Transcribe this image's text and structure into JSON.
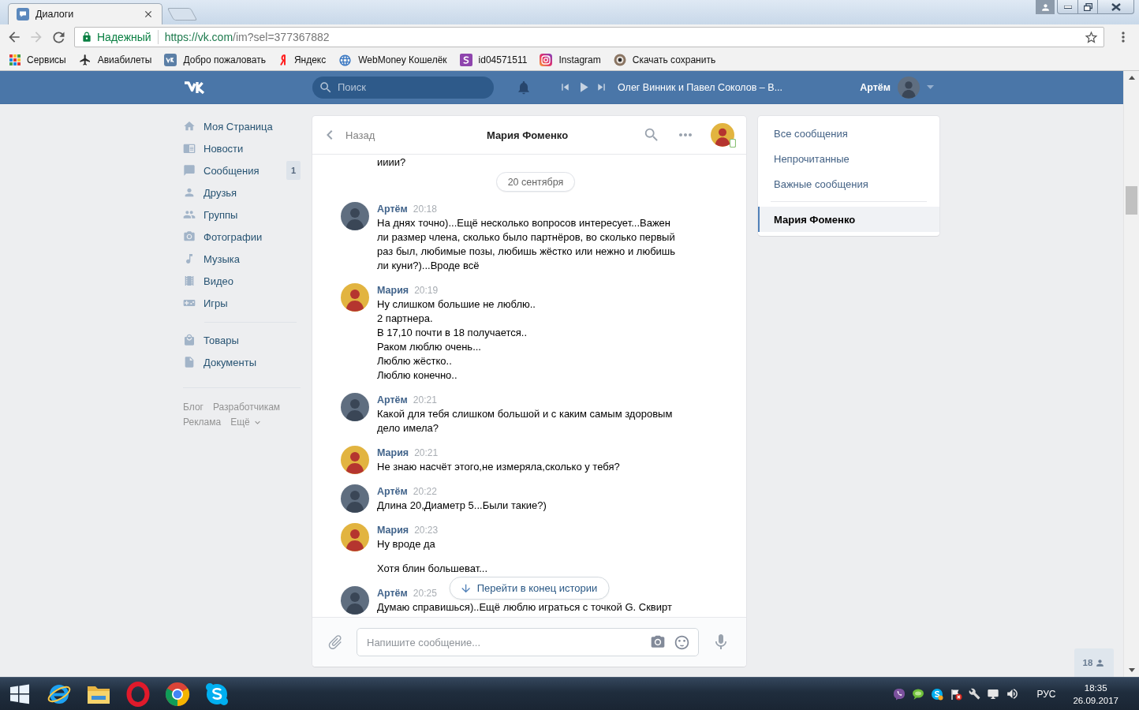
{
  "browser": {
    "tabs": [
      {
        "title": "Диалоги",
        "selected": true
      }
    ],
    "forward_button": {
      "disabled": true
    },
    "address": {
      "security": "Надежный",
      "host": "https://vk.com",
      "path": "/im?sel=377367882"
    },
    "bookmarks": [
      {
        "label": "Сервисы"
      },
      {
        "label": "Авиабилеты"
      },
      {
        "label": "Добро пожаловать"
      },
      {
        "label": "Яндекс"
      },
      {
        "label": "WebMoney Кошелёк"
      },
      {
        "label": "id04571511"
      },
      {
        "label": "Instagram"
      },
      {
        "label": "Скачать сохранить"
      }
    ]
  },
  "header": {
    "search": {
      "placeholder": "Поиск"
    },
    "player": {
      "track": "Олег Винник и Павел Соколов – В..."
    },
    "user": {
      "name": "Артём"
    }
  },
  "nav": {
    "items": [
      {
        "label": "Моя Страница"
      },
      {
        "label": "Новости"
      },
      {
        "label": "Сообщения",
        "count": "1"
      },
      {
        "label": "Друзья"
      },
      {
        "label": "Группы"
      },
      {
        "label": "Фотографии"
      },
      {
        "label": "Музыка"
      },
      {
        "label": "Видео"
      },
      {
        "label": "Игры"
      }
    ],
    "extra_items": [
      {
        "label": "Товары"
      },
      {
        "label": "Документы"
      }
    ],
    "footer_links": [
      {
        "label": "Блог",
        "kind": "link"
      },
      {
        "label": "Разработчикам",
        "kind": "link"
      },
      {
        "label": "Реклама",
        "kind": "link"
      },
      {
        "label": "Ещё",
        "kind": "menu"
      }
    ]
  },
  "chat": {
    "back": "Назад",
    "title": "Мария Фоменко",
    "online": true,
    "earlier_text": "ииии?",
    "date": "20 сентября",
    "messages": [
      {
        "author": "Артём",
        "kind": "self",
        "time": "20:18",
        "texts": [
          "На днях точно)...Ещё несколько вопросов интересует...Важен ли размер члена, сколько было партнёров, во сколько первый раз был, любимые позы, любишь жёстко или нежно и любишь ли куни?)...Вроде всё"
        ]
      },
      {
        "author": "Мария",
        "kind": "peer",
        "time": "20:19",
        "texts": [
          "Ну слишком большие не люблю..\n2 партнера.\nВ 17,10 почти в 18 получается..\nРаком люблю очень...\nЛюблю жёстко..\nЛюблю конечно.."
        ]
      },
      {
        "author": "Артём",
        "kind": "self",
        "time": "20:21",
        "texts": [
          "Какой для тебя слишком большой и с каким самым здоровым дело имела?"
        ]
      },
      {
        "author": "Мария",
        "kind": "peer",
        "time": "20:21",
        "texts": [
          "Не знаю насчёт этого,не измеряла,сколько у тебя?"
        ]
      },
      {
        "author": "Артём",
        "kind": "self",
        "time": "20:22",
        "texts": [
          "Длина 20,Диаметр 5...Были такие?)"
        ]
      },
      {
        "author": "Мария",
        "kind": "peer",
        "time": "20:23",
        "texts": [
          "Ну вроде да",
          "Хотя блин большеват..."
        ]
      },
      {
        "author": "Артём",
        "kind": "self",
        "time": "20:25",
        "texts": [
          "Думаю справишься)..Ещё люблю играться с точкой G. Сквирт"
        ]
      }
    ],
    "jump_button": "Перейти в конец истории",
    "composer": {
      "placeholder": "Напишите сообщение..."
    }
  },
  "filters": {
    "items": [
      {
        "label": "Все сообщения",
        "selected": false
      },
      {
        "label": "Непрочитанные",
        "selected": false
      },
      {
        "label": "Важные сообщения",
        "selected": false
      }
    ],
    "dialogs": [
      {
        "label": "Мария Фоменко",
        "selected": true
      }
    ]
  },
  "online_friends": {
    "count": "18"
  },
  "taskbar": {
    "language": "РУС",
    "time": "18:35",
    "date": "26.09.2017"
  }
}
